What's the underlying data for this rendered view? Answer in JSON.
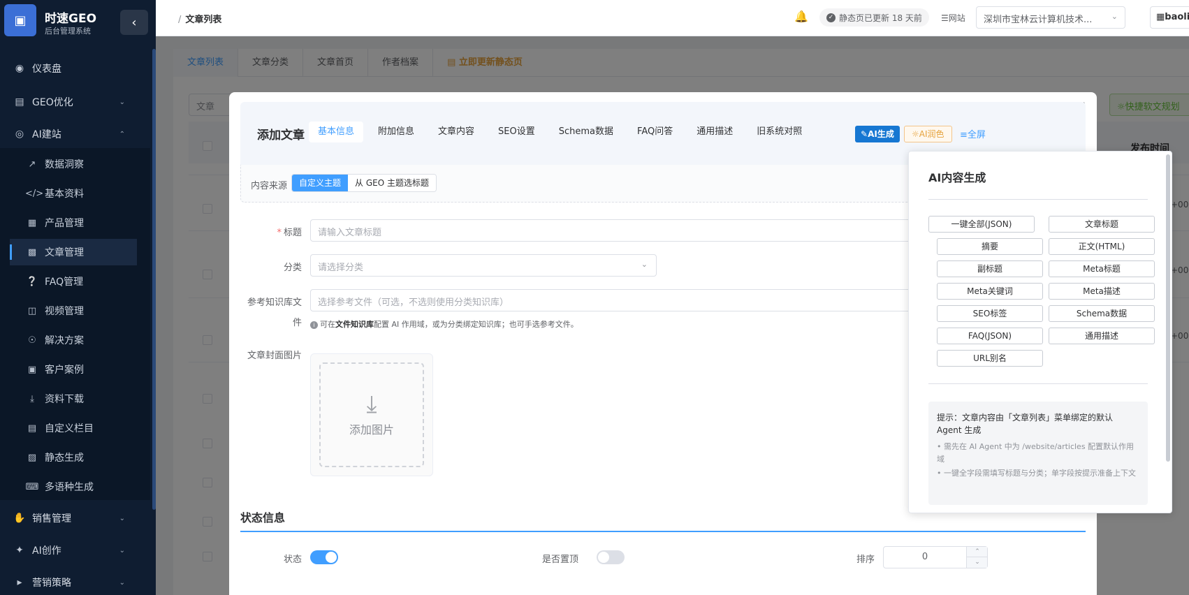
{
  "sidebar": {
    "brand_title": "时速GEO",
    "brand_subtitle": "后台管理系统",
    "items": [
      {
        "label": "仪表盘"
      },
      {
        "label": "GEO优化"
      },
      {
        "label": "AI建站"
      },
      {
        "label": "销售管理"
      },
      {
        "label": "AI创作"
      },
      {
        "label": "营销策略"
      }
    ],
    "sub_items": [
      {
        "label": "数据洞察"
      },
      {
        "label": "基本资料"
      },
      {
        "label": "产品管理"
      },
      {
        "label": "文章管理"
      },
      {
        "label": "FAQ管理"
      },
      {
        "label": "视频管理"
      },
      {
        "label": "解决方案"
      },
      {
        "label": "客户案例"
      },
      {
        "label": "资料下载"
      },
      {
        "label": "自定义栏目"
      },
      {
        "label": "静态生成"
      },
      {
        "label": "多语种生成"
      }
    ]
  },
  "header": {
    "breadcrumb_sep": "/",
    "breadcrumb": "文章列表",
    "status": "静态页已更新 18 天前",
    "site_label": "网站",
    "site_value": "深圳市宝林云计算机技术...",
    "user": "baolin"
  },
  "page_tabs": [
    {
      "label": "文章列表"
    },
    {
      "label": "文章分类"
    },
    {
      "label": "文章首页"
    },
    {
      "label": "作者档案"
    },
    {
      "label": "立即更新静态页"
    }
  ],
  "background": {
    "search_placeholder": "文章",
    "green_button": "快捷软文规划",
    "col_publish": "发布时间",
    "row_tail": "+00"
  },
  "dialog": {
    "title": "添加文章",
    "tabs": [
      {
        "label": "基本信息"
      },
      {
        "label": "附加信息"
      },
      {
        "label": "文章内容"
      },
      {
        "label": "SEO设置"
      },
      {
        "label": "Schema数据"
      },
      {
        "label": "FAQ问答"
      },
      {
        "label": "通用描述"
      },
      {
        "label": "旧系统对照"
      }
    ],
    "ai_generate": "AI生成",
    "ai_polish": "AI润色",
    "fullscreen": "全屏",
    "source_label": "内容来源",
    "source_options": [
      {
        "label": "自定义主题"
      },
      {
        "label": "从 GEO 主题选标题"
      }
    ],
    "title_label": "标题",
    "title_placeholder": "请输入文章标题",
    "category_label": "分类",
    "category_placeholder": "请选择分类",
    "kb_label_1": "参考知识库文",
    "kb_label_2": "件",
    "kb_placeholder": "选择参考文件（可选，不选则使用分类知识库）",
    "hint_pre": "可在",
    "hint_bold": "文件知识库",
    "hint_post": "配置 AI 作用域，或为分类绑定知识库；也可手选参考文件。",
    "cover_label": "文章封面图片",
    "upload_text": "添加图片",
    "section_status": "状态信息",
    "status_label": "状态",
    "status_on": true,
    "top_label": "是否置顶",
    "top_on": false,
    "sort_label": "排序",
    "sort_value": "0"
  },
  "ai_panel": {
    "title": "AI内容生成",
    "buttons": [
      {
        "label": "一键全部(JSON)"
      },
      {
        "label": "文章标题"
      },
      {
        "label": "摘要"
      },
      {
        "label": "正文(HTML)"
      },
      {
        "label": "副标题"
      },
      {
        "label": "Meta标题"
      },
      {
        "label": "Meta关键词"
      },
      {
        "label": "Meta描述"
      },
      {
        "label": "SEO标签"
      },
      {
        "label": "Schema数据"
      },
      {
        "label": "FAQ(JSON)"
      },
      {
        "label": "通用描述"
      },
      {
        "label": "URL别名"
      }
    ],
    "tip_main": "提示：文章内容由「文章列表」菜单绑定的默认 Agent 生成",
    "tip_1": "• 需先在 AI Agent 中为 /website/articles 配置默认作用域",
    "tip_2": "• 一键全字段需填写标题与分类；单字段按提示准备上下文"
  }
}
